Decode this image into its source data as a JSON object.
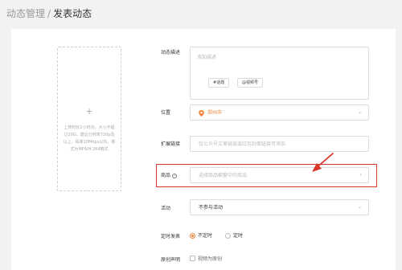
{
  "breadcrumb": {
    "parent": "动态管理",
    "separator": "/",
    "current": "发表动态"
  },
  "upload": {
    "plus": "+",
    "tip": "上传时长1小时内，大小不超过20G，建议分辨率720p及以上，码率10Mbps以内，格式为MP4/H.264格式"
  },
  "form": {
    "description": {
      "label": "动态描述",
      "placeholder": "添加描述",
      "tags": [
        "#话题",
        "@视频号"
      ]
    },
    "location": {
      "label": "位置",
      "value": "郑州市"
    },
    "extended_link": {
      "label": "扩展链接",
      "placeholder": "仅公众号文章链接或红包封面链接可添加"
    },
    "product": {
      "label": "商品",
      "help_icon": "?",
      "placeholder": "选择商品橱窗中的商品"
    },
    "activity": {
      "label": "活动",
      "value": "不参与活动"
    },
    "scheduled_post": {
      "label": "定时发表",
      "options": [
        "不定时",
        "定时"
      ],
      "selected": "不定时"
    },
    "original": {
      "label": "原创声明",
      "checkbox_label": "视频为原创"
    }
  },
  "colors": {
    "accent": "#f0833a",
    "annotation": "#d9362b"
  }
}
